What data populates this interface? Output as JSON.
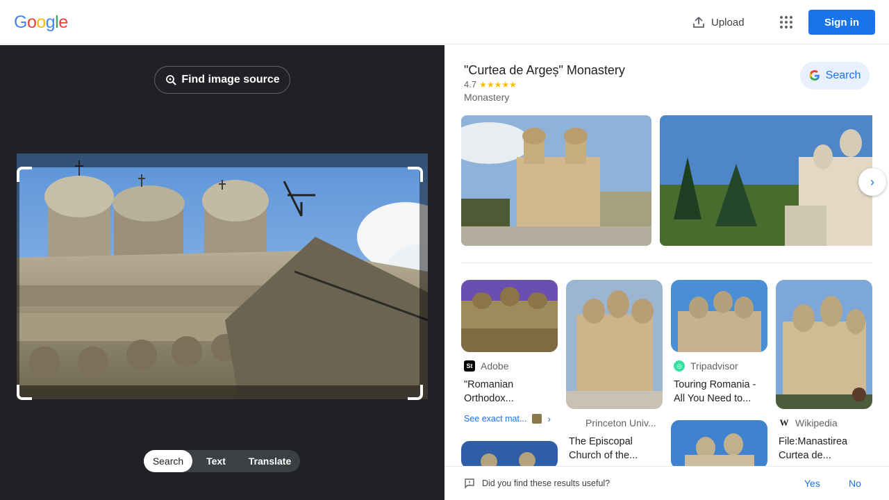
{
  "header": {
    "logo_letters": [
      {
        "ch": "G",
        "color": "#4285f4"
      },
      {
        "ch": "o",
        "color": "#ea4335"
      },
      {
        "ch": "o",
        "color": "#fbbc05"
      },
      {
        "ch": "g",
        "color": "#4285f4"
      },
      {
        "ch": "l",
        "color": "#34a853"
      },
      {
        "ch": "e",
        "color": "#ea4335"
      }
    ],
    "upload_label": "Upload",
    "apps_icon": "apps-grid-icon",
    "signin_label": "Sign in"
  },
  "lens": {
    "find_source_label": "Find image source",
    "modes": [
      {
        "label": "Search",
        "active": true
      },
      {
        "label": "Text",
        "active": false
      },
      {
        "label": "Translate",
        "active": false
      }
    ]
  },
  "knowledge_panel": {
    "title": "\"Curtea de Argeș\" Monastery",
    "rating": "4.7",
    "stars": "★★★★★",
    "type": "Monastery",
    "search_label": "Search"
  },
  "results": [
    {
      "source": "Adobe",
      "title": "\"Romanian Orthodox..."
    },
    {
      "source": "Princeton Univ...",
      "title": "The Episcopal Church of the..."
    },
    {
      "source": "Tripadvisor",
      "title": "Touring Romania - All You Need to..."
    },
    {
      "source": "Wikipedia",
      "title": "File:Manastirea Curtea de..."
    }
  ],
  "see_exact_label": "See exact mat...",
  "feedback": {
    "question": "Did you find these results useful?",
    "yes": "Yes",
    "no": "No"
  },
  "colors": {
    "accent": "#1a73e8",
    "left_bg": "#202124",
    "star": "#fbbc04"
  }
}
